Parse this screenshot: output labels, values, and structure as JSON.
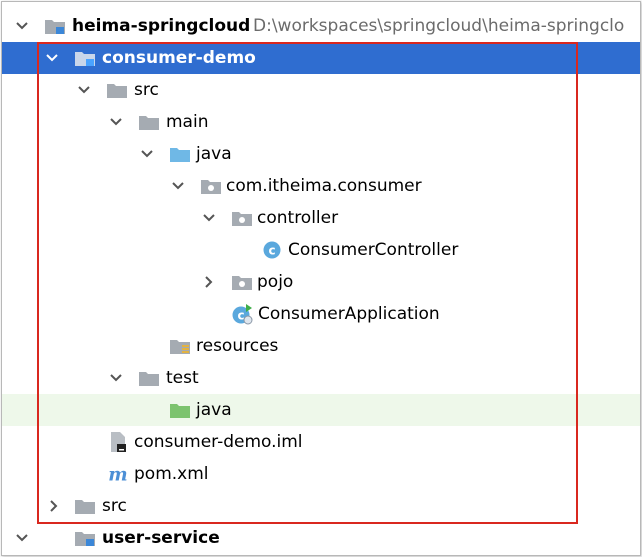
{
  "tree": {
    "root": {
      "label": "heima-springcloud",
      "path": "D:\\workspaces\\springcloud\\heima-springclo"
    },
    "consumer_demo": "consumer-demo",
    "src": "src",
    "main": "main",
    "java_main": "java",
    "package": "com.itheima.consumer",
    "controller": "controller",
    "consumer_controller": "ConsumerController",
    "pojo": "pojo",
    "consumer_application": "ConsumerApplication",
    "resources": "resources",
    "test": "test",
    "java_test": "java",
    "iml": "consumer-demo.iml",
    "pom": "pom.xml",
    "root_src": "src",
    "user_service": "user-service"
  },
  "icons": {
    "chevron_expanded": "chevron-down-icon",
    "chevron_collapsed": "chevron-right-icon",
    "folder": "folder-icon",
    "module": "module-folder-icon",
    "source_root": "source-root-icon",
    "test_root": "test-root-icon",
    "package": "package-icon",
    "class": "class-icon",
    "spring_class": "spring-boot-class-icon",
    "resources": "resources-folder-icon",
    "iml": "iml-file-icon",
    "maven": "maven-icon"
  },
  "colors": {
    "selection": "#2f6dd0",
    "test_highlight": "#eef8ea",
    "annotation_box": "#d9281f",
    "folder": "#a5abb2",
    "source_root": "#6fb8e6",
    "test_root": "#7cc36e",
    "class_badge": "#5aa8dd"
  }
}
